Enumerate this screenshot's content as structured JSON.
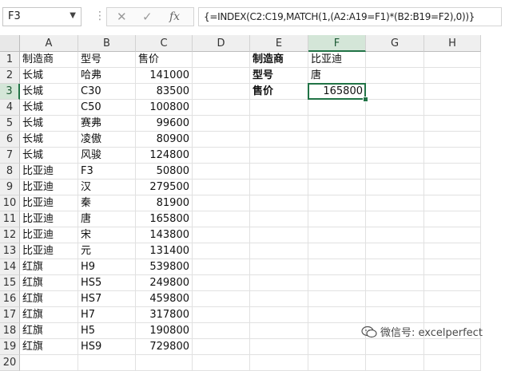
{
  "name_box": {
    "value": "F3"
  },
  "formula_bar": {
    "cancel_glyph": "✕",
    "enter_glyph": "✓",
    "fx_glyph": "fx",
    "formula": "{=INDEX(C2:C19,MATCH(1,(A2:A19=F1)*(B2:B19=F2),0))}"
  },
  "columns": [
    "A",
    "B",
    "C",
    "D",
    "E",
    "F",
    "G",
    "H"
  ],
  "selected_column": "F",
  "selected_row": "3",
  "rows": [
    "1",
    "2",
    "3",
    "4",
    "5",
    "6",
    "7",
    "8",
    "9",
    "10",
    "11",
    "12",
    "13",
    "14",
    "15",
    "16",
    "17",
    "18",
    "19",
    "20"
  ],
  "table": [
    [
      "制造商",
      "型号",
      "售价"
    ],
    [
      "长城",
      "哈弗",
      "141000"
    ],
    [
      "长城",
      "C30",
      "83500"
    ],
    [
      "长城",
      "C50",
      "100800"
    ],
    [
      "长城",
      "赛弗",
      "99600"
    ],
    [
      "长城",
      "凌傲",
      "80900"
    ],
    [
      "长城",
      "风骏",
      "124800"
    ],
    [
      "比亚迪",
      "F3",
      "50800"
    ],
    [
      "比亚迪",
      "汉",
      "279500"
    ],
    [
      "比亚迪",
      "秦",
      "81900"
    ],
    [
      "比亚迪",
      "唐",
      "165800"
    ],
    [
      "比亚迪",
      "宋",
      "143800"
    ],
    [
      "比亚迪",
      "元",
      "131400"
    ],
    [
      "红旗",
      "H9",
      "539800"
    ],
    [
      "红旗",
      "HS5",
      "249800"
    ],
    [
      "红旗",
      "HS7",
      "459800"
    ],
    [
      "红旗",
      "H7",
      "317800"
    ],
    [
      "红旗",
      "H5",
      "190800"
    ],
    [
      "红旗",
      "HS9",
      "729800"
    ]
  ],
  "lookup": {
    "e1": "制造商",
    "f1": "比亚迪",
    "e2": "型号",
    "f2": "唐",
    "e3": "售价",
    "f3": "165800"
  },
  "watermark": {
    "text": "微信号: excelperfect"
  }
}
